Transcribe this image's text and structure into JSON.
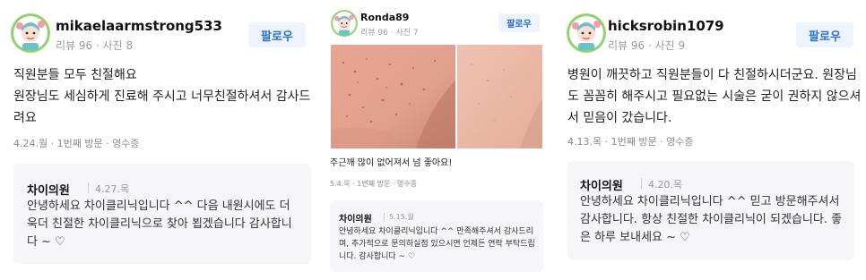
{
  "reviews": [
    {
      "username": "mikaelaarmstrong533",
      "review_count": "리뷰 96",
      "photo_count": "사진 8",
      "follow_label": "팔로우",
      "text": "직원분들 모두 친절해요\n원장님도 세심하게 진료해 주시고 너무친절하셔서 감사드려요",
      "visit_info": "4.24.월 · 1번째 방문 · 영수증",
      "reply": {
        "owner": "차이의원",
        "date": "4.27.목",
        "text": "안녕하세요 차이클리닉입니다 ^^ 다음 내원시에도 더욱더 친절한 차이클리닉으로 찾아 뵙겠습니다 감사합니다 ~ ♡"
      }
    },
    {
      "username": "Ronda89",
      "review_count": "리뷰 96",
      "photo_count": "사진 7",
      "follow_label": "팔로우",
      "text": "주근깨 많이 없어져서 넘 좋아요!",
      "visit_info": "5.4.목 · 1번째 방문 · 영수증",
      "reply": {
        "owner": "차이의원",
        "date": "5.15.월",
        "text": "안녕하세요 차이클리닉입니다 ^^ 만족해주셔서 감사드리며, 추가적으로 문의하실점 있으시면 언제든 연락 부탁드립니다. 감사합니다 ~ ♡"
      }
    },
    {
      "username": "hicksrobin1079",
      "review_count": "리뷰 96",
      "photo_count": "사진 9",
      "follow_label": "팔로우",
      "text": "병원이 깨끗하고 직원분들이 다 친절하시더군요. 원장님도 꼼꼼히 해주시고 필요없는 시술은 굳이 권하지 않으셔서 믿음이 갔습니다.",
      "visit_info": "4.13.목 · 1번째 방문 · 영수증",
      "reply": {
        "owner": "차이의원",
        "date": "4.20.목",
        "text": "안녕하세요 차이클리닉입니다 ^^ 믿고 방문해주셔서 감사합니다. 항상 친절한 차이클리닉이 되겠습니다. 좋은 하루 보내세요 ~ ♡"
      }
    }
  ],
  "colors": {
    "accent": "#2b6fd6",
    "follow_bg": "#eef4fb",
    "reply_bg": "#f6f6f8",
    "avatar_ring": "#8fd16a"
  },
  "icons": [
    "avatar-icon",
    "skin-photo-left",
    "skin-photo-right"
  ]
}
